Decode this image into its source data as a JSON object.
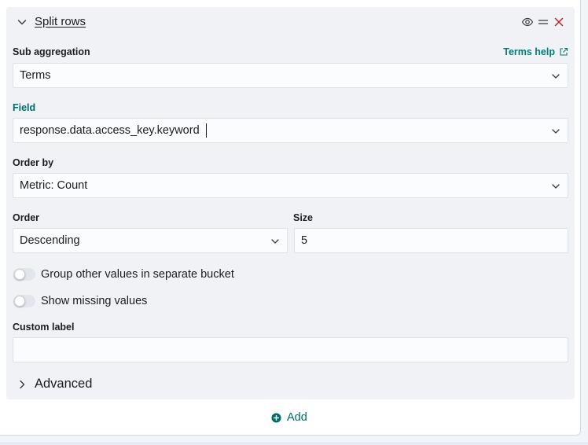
{
  "header": {
    "title": "Split rows",
    "icons": [
      "chevron-down-icon",
      "eye-icon",
      "drag-handle-icon",
      "close-icon"
    ]
  },
  "sub_aggregation": {
    "label": "Sub aggregation",
    "help_link": "Terms help",
    "value": "Terms"
  },
  "field": {
    "label": "Field",
    "value": "response.data.access_key.keyword"
  },
  "order_by": {
    "label": "Order by",
    "value": "Metric: Count"
  },
  "order": {
    "label": "Order",
    "value": "Descending"
  },
  "size": {
    "label": "Size",
    "value": "5"
  },
  "toggles": {
    "group_other": {
      "label": "Group other values in separate bucket",
      "on": false
    },
    "show_missing": {
      "label": "Show missing values",
      "on": false
    }
  },
  "custom_label": {
    "label": "Custom label",
    "value": ""
  },
  "advanced": {
    "label": "Advanced"
  },
  "footer": {
    "add_label": "Add"
  },
  "colors": {
    "accent": "#006d6a",
    "close": "#bd271e",
    "panel_bg": "#f0f2f5"
  }
}
